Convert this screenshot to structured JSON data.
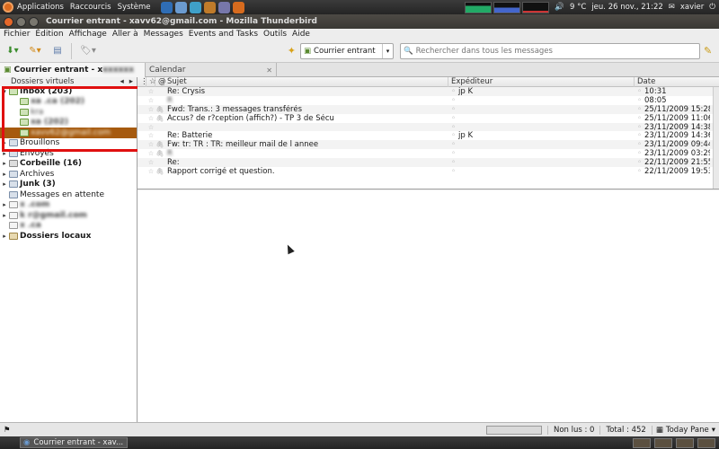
{
  "panel": {
    "menus": [
      "Applications",
      "Raccourcis",
      "Système"
    ],
    "weather": "9 °C",
    "clock": "jeu. 26 nov., 21:22",
    "user": "xavier"
  },
  "window": {
    "title": "Courrier entrant - xavv62@gmail.com - Mozilla Thunderbird"
  },
  "menubar": [
    "Fichier",
    "Édition",
    "Affichage",
    "Aller à",
    "Messages",
    "Events and Tasks",
    "Outils",
    "Aide"
  ],
  "toolbar": {
    "folder_selected": "Courrier entrant",
    "search_placeholder": "Rechercher dans tous les messages"
  },
  "tabs": [
    {
      "label": "Courrier entrant - x"
    },
    {
      "label": "Calendar"
    }
  ],
  "folder_pane": {
    "view_label": "Dossiers virtuels",
    "folders": [
      {
        "label": "Inbox (203)",
        "twisty": "▾",
        "indent": 0,
        "bold": true,
        "icon": "inbox-icon",
        "blurred": false
      },
      {
        "label": "xa  .ca (202)",
        "twisty": "",
        "indent": 1,
        "bold": true,
        "icon": "inbox-icon",
        "blurred": true
      },
      {
        "label": "kra  ",
        "twisty": "",
        "indent": 1,
        "bold": false,
        "icon": "inbox-icon",
        "blurred": true
      },
      {
        "label": "xa  (202)",
        "twisty": "",
        "indent": 1,
        "bold": true,
        "icon": "inbox-icon",
        "blurred": true
      },
      {
        "label": "xavv62@gmail.com",
        "twisty": "",
        "indent": 1,
        "bold": false,
        "icon": "inbox-icon",
        "blurred": true,
        "selected": true
      },
      {
        "label": "Brouillons",
        "twisty": "▸",
        "indent": 0,
        "bold": false,
        "icon": "folder-icon",
        "blurred": false
      },
      {
        "label": "Envoyés",
        "twisty": "▸",
        "indent": 0,
        "bold": false,
        "icon": "folder-icon",
        "blurred": false
      },
      {
        "label": "Corbeille (16)",
        "twisty": "▸",
        "indent": 0,
        "bold": true,
        "icon": "trash-icon",
        "blurred": false
      },
      {
        "label": "Archives",
        "twisty": "▸",
        "indent": 0,
        "bold": false,
        "icon": "folder-icon",
        "blurred": false
      },
      {
        "label": "Junk (3)",
        "twisty": "▸",
        "indent": 0,
        "bold": true,
        "icon": "folder-icon",
        "blurred": false
      },
      {
        "label": "Messages en attente",
        "twisty": "",
        "indent": 0,
        "bold": false,
        "icon": "folder-icon",
        "blurred": false
      },
      {
        "label": "x  .com",
        "twisty": "▸",
        "indent": 0,
        "bold": true,
        "icon": "account-icon",
        "blurred": true
      },
      {
        "label": "k  r@gmail.com",
        "twisty": "▸",
        "indent": 0,
        "bold": true,
        "icon": "account-icon",
        "blurred": true
      },
      {
        "label": "x  .ca",
        "twisty": "",
        "indent": 0,
        "bold": true,
        "icon": "account-icon",
        "blurred": true
      },
      {
        "label": "Dossiers locaux",
        "twisty": "▸",
        "indent": 0,
        "bold": true,
        "icon": "local-folders-icon",
        "blurred": false
      }
    ]
  },
  "message_list": {
    "columns": {
      "subject": "Sujet",
      "sender": "Expéditeur",
      "date": "Date"
    },
    "rows": [
      {
        "subject": "Re: Crysis",
        "sender": "jp K",
        "date": "10:31",
        "att": false,
        "blur_subject": false,
        "blur_sender": false
      },
      {
        "subject": "R  ",
        "sender": "  ",
        "date": "08:05",
        "att": false,
        "blur_subject": true,
        "blur_sender": true
      },
      {
        "subject": "Fwd: Trans.: 3 messages transférés",
        "sender": "  ",
        "date": "25/11/2009 15:28",
        "att": true,
        "blur_subject": false,
        "blur_sender": true
      },
      {
        "subject": "Accus? de r?ception (affich?) - TP 3 de Sécu",
        "sender": "  ",
        "date": "25/11/2009 11:06",
        "att": true,
        "blur_subject": false,
        "blur_sender": true
      },
      {
        "subject": "  ",
        "sender": "  ",
        "date": "23/11/2009 14:38",
        "att": false,
        "blur_subject": true,
        "blur_sender": true
      },
      {
        "subject": "Re: Batterie",
        "sender": "jp K",
        "date": "23/11/2009 14:36",
        "att": false,
        "blur_subject": false,
        "blur_sender": false
      },
      {
        "subject": "Fw: tr: TR : TR: meilleur mail de l annee",
        "sender": "  ",
        "date": "23/11/2009 09:44",
        "att": true,
        "blur_subject": false,
        "blur_sender": true
      },
      {
        "subject": "R  ",
        "sender": "  ",
        "date": "23/11/2009 03:29",
        "att": true,
        "blur_subject": true,
        "blur_sender": true
      },
      {
        "subject": "Re:",
        "sender": "  ",
        "date": "22/11/2009 21:55",
        "att": false,
        "blur_subject": false,
        "blur_sender": true
      },
      {
        "subject": "Rapport corrigé et question.",
        "sender": "  ",
        "date": "22/11/2009 19:53",
        "att": true,
        "blur_subject": false,
        "blur_sender": true
      }
    ]
  },
  "status": {
    "unread": "Non lus : 0",
    "total": "Total : 452",
    "today_pane": "Today Pane"
  },
  "taskbar": {
    "task_label": "Courrier entrant - xav..."
  }
}
